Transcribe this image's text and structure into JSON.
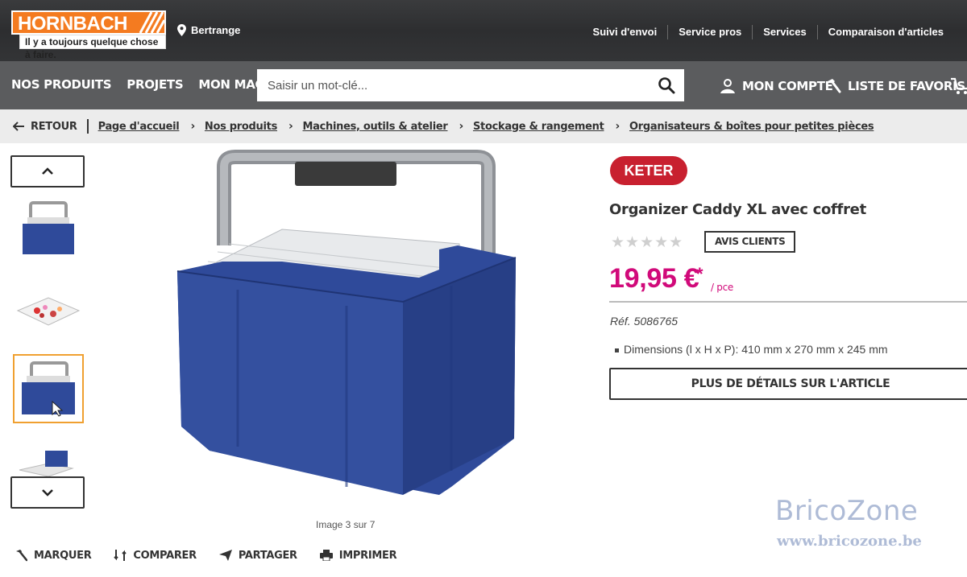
{
  "logo": {
    "name": "HORNBACH",
    "tagline": "Il y a toujours quelque chose à faire."
  },
  "location": "Bertrange",
  "top_links": [
    "Suivi d'envoi",
    "Service pros",
    "Services",
    "Comparaison d'articles"
  ],
  "nav": {
    "items": [
      "NOS PRODUITS",
      "PROJETS",
      "MON MAGASIN"
    ],
    "search_placeholder": "Saisir un mot-clé...",
    "account": "MON COMPTE",
    "favorites": "LISTE DE FAVORIS"
  },
  "breadcrumb": {
    "back": "RETOUR",
    "items": [
      "Page d'accueil",
      "Nos produits",
      "Machines, outils & atelier",
      "Stockage & rangement",
      "Organisateurs & boîtes pour petites pièces"
    ]
  },
  "gallery": {
    "caption": "Image 3 sur 7",
    "active_index": 3
  },
  "actions": [
    "MARQUER",
    "COMPARER",
    "PARTAGER",
    "IMPRIMER"
  ],
  "product": {
    "brand": "KETER",
    "title": "Organizer Caddy XL avec coffret",
    "rating": 0,
    "reviews_button": "AVIS CLIENTS",
    "price": "19,95 €",
    "price_mark": "*",
    "unit": "/ pce",
    "ref": "Réf. 5086765",
    "dimensions": "Dimensions (l x H x P): 410 mm x 270 mm x 245 mm",
    "details_button": "PLUS DE DÉTAILS SUR L'ARTICLE"
  },
  "watermark": {
    "title": "BricoZone",
    "url": "www.bricozone.be"
  },
  "colors": {
    "accent": "#f47b20",
    "price": "#d10a7a",
    "topbar": "#2d2e30",
    "navbar": "#5b5c5e",
    "box_blue": "#2f4a9a"
  }
}
